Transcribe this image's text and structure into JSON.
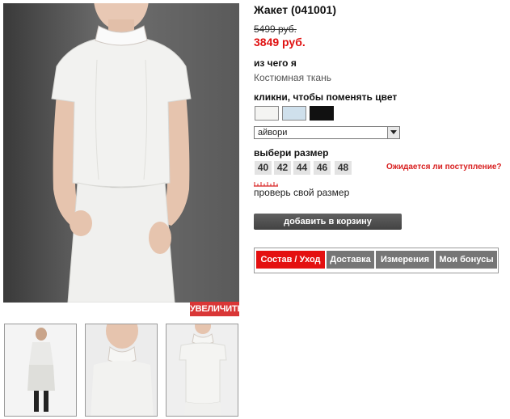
{
  "product": {
    "title": "Жакет (041001)",
    "old_price": "5499 руб.",
    "new_price": "3849 руб."
  },
  "material": {
    "label": "из чего я",
    "value": "Костюмная ткань"
  },
  "color": {
    "label": "кликни, чтобы поменять цвет",
    "swatches": [
      {
        "name": "ivory",
        "hex": "#f4f4f2"
      },
      {
        "name": "light-blue",
        "hex": "#cfe0ec"
      },
      {
        "name": "black",
        "hex": "#111111"
      }
    ],
    "selected": "айвори"
  },
  "size": {
    "label": "выбери размер",
    "options": [
      "40",
      "42",
      "44",
      "46",
      "48"
    ],
    "await_link": "Ожидается ли поступление?",
    "check_link": "проверь свой размер",
    "ruler_icon": "ruler-icon"
  },
  "actions": {
    "zoom": "УВЕЛИЧИТЬ",
    "add_to_cart": "добавить в корзину"
  },
  "tabs": [
    {
      "label": "Состав / Уход",
      "active": true
    },
    {
      "label": "Доставка",
      "active": false
    },
    {
      "label": "Измерения",
      "active": false
    },
    {
      "label": "Мои бонусы",
      "active": false
    }
  ],
  "colors": {
    "price_red": "#e01010",
    "tab_active": "#e41010",
    "tab_inactive": "#767676",
    "zoom_red": "#d93636"
  }
}
